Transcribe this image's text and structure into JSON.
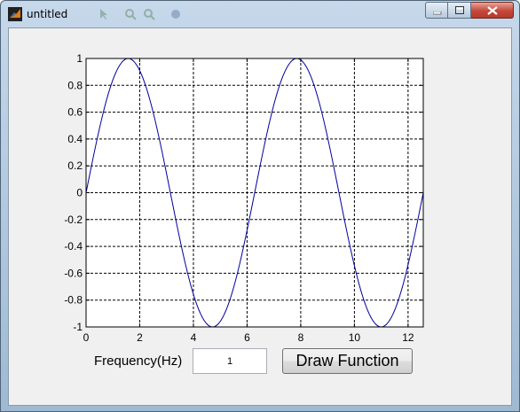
{
  "window": {
    "title": "untitled",
    "icons": [
      "matlab-icon",
      "minimize-icon",
      "maximize-icon",
      "close-icon"
    ]
  },
  "controls": {
    "frequency_label": "Frequency(Hz)",
    "frequency_value": "1",
    "draw_button_label": "Draw Function"
  },
  "chart_data": {
    "type": "line",
    "function": "sin(x)",
    "series": [
      {
        "color": "#0000a0",
        "x": [
          0,
          0.5,
          1,
          1.5708,
          2,
          2.5,
          3,
          3.1416,
          3.5,
          4,
          4.7124,
          5,
          5.5,
          6,
          6.2832,
          6.5,
          7,
          7.854,
          8,
          8.5,
          9,
          9.4248,
          10,
          10.5,
          10.9956,
          11.5,
          12,
          12.5664
        ],
        "y": [
          0,
          0.479,
          0.841,
          1.0,
          0.909,
          0.598,
          0.141,
          0.0,
          -0.351,
          -0.757,
          -1.0,
          -0.959,
          -0.706,
          -0.279,
          0.0,
          0.215,
          0.657,
          1.0,
          0.989,
          0.798,
          0.412,
          0.0,
          -0.544,
          -0.88,
          -1.0,
          -0.875,
          -0.537,
          0.0
        ]
      }
    ],
    "xlim": [
      0,
      12.5664
    ],
    "ylim": [
      -1,
      1
    ],
    "xticks": [
      "0",
      "2",
      "4",
      "6",
      "8",
      "10",
      "12"
    ],
    "yticks": [
      "1",
      "0.8",
      "0.6",
      "0.4",
      "0.2",
      "0",
      "-0.2",
      "-0.4",
      "-0.6",
      "-0.8",
      "-1"
    ],
    "grid": true,
    "title": "",
    "xlabel": "",
    "ylabel": ""
  }
}
